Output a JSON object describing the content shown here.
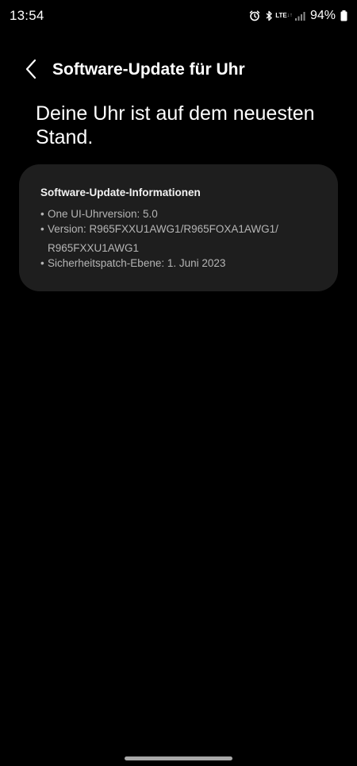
{
  "status_bar": {
    "time": "13:54",
    "lte": "LTE",
    "battery": "94%",
    "icons": [
      "alarm-icon",
      "bluetooth-icon",
      "lte-icon",
      "signal-icon",
      "battery-icon"
    ]
  },
  "header": {
    "title": "Software-Update für Uhr",
    "back_icon": "chevron-left-icon"
  },
  "headline": "Deine Uhr ist auf dem neuesten Stand.",
  "info_card": {
    "title": "Software-Update-Informationen",
    "bullet": "•",
    "lines": [
      "One UI-Uhrversion: 5.0",
      "Version: R965FXXU1AWG1/R965FOXA1AWG1/",
      "R965FXXU1AWG1",
      "Sicherheitspatch-Ebene: 1. Juni 2023"
    ]
  },
  "colors": {
    "background": "#000000",
    "card": "#1e1e1e",
    "text_primary": "#ffffff",
    "text_secondary": "#b5b5b5"
  }
}
